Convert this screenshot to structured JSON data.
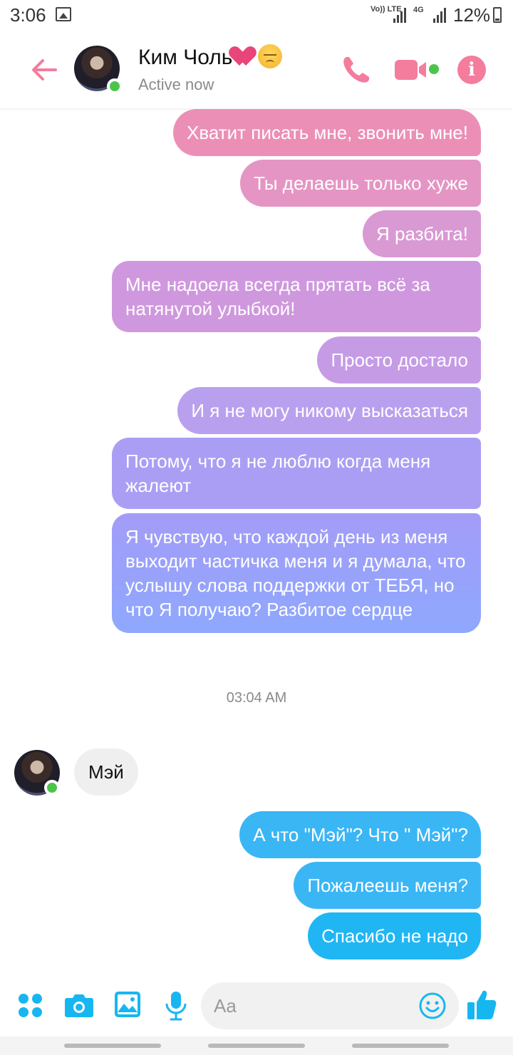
{
  "status_bar": {
    "time": "3:06",
    "volte": "Vo)) LTE",
    "network": "4G",
    "battery": "12%"
  },
  "header": {
    "contact_name": "Ким Чоль",
    "contact_status": "Active now",
    "icons": [
      "back-arrow-icon",
      "phone-icon",
      "video-camera-icon",
      "info-icon"
    ],
    "accent_color": "#f47c9d"
  },
  "messages": {
    "sent_1": "Хватит писать мне, звонить мне!",
    "sent_2": "Ты делаешь только хуже",
    "sent_3": "Я разбита!",
    "sent_4": "Мне надоела всегда прятать всё за натянутой улыбкой!",
    "sent_5": "Просто достало",
    "sent_6": "И я не могу никому высказаться",
    "sent_7": "Потому, что я не люблю когда меня жалеют",
    "sent_8": "Я чувствую, что каждой день из меня выходит частичка меня и я думала, что услышу слова поддержки от ТЕБЯ, но что Я получаю? Разбитое сердце",
    "timestamp": "03:04 AM",
    "received_1": "Мэй",
    "sent_9": "А что \"Мэй\"? Что \" Мэй\"?",
    "sent_10": "Пожалеешь меня?",
    "sent_11": "Спасибо не надо"
  },
  "composer": {
    "placeholder": "Aa",
    "accent_color": "#16b7f1",
    "icons": [
      "apps-icon",
      "camera-icon",
      "gallery-icon",
      "microphone-icon",
      "emoji-icon",
      "thumbs-up-icon"
    ]
  }
}
